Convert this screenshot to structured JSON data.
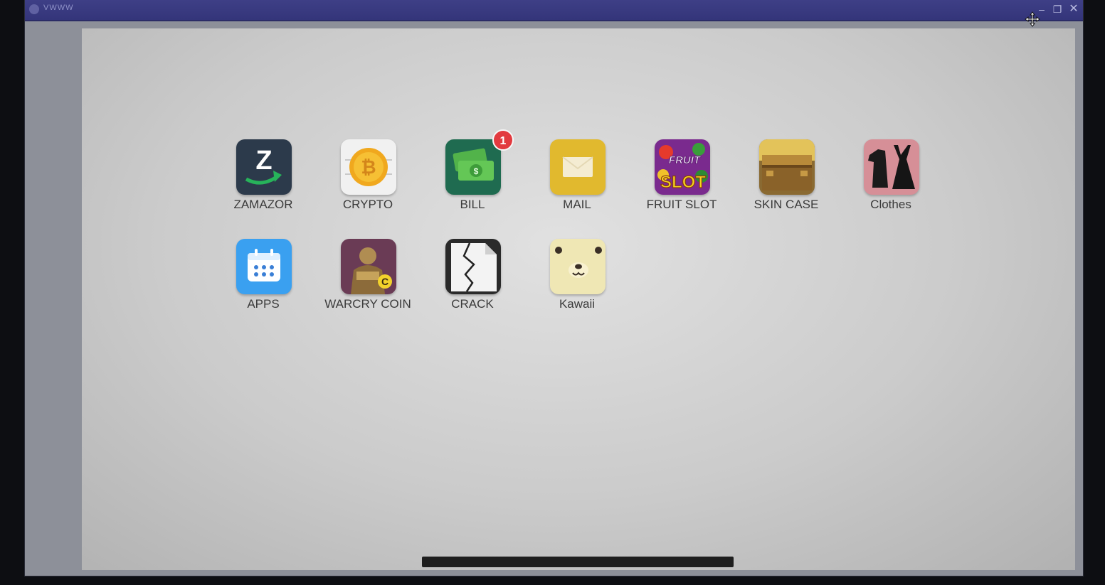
{
  "window": {
    "title": "VWWW",
    "controls": {
      "minimize": "–",
      "maximize": "❐",
      "close": "✕"
    }
  },
  "apps": [
    {
      "label": "ZAMAZOR",
      "icon": "zamazor-icon"
    },
    {
      "label": "CRYPTO",
      "icon": "bitcoin-coin-icon"
    },
    {
      "label": "BILL",
      "icon": "money-bills-icon",
      "badge": "1"
    },
    {
      "label": "MAIL",
      "icon": "envelope-icon"
    },
    {
      "label": "FRUIT SLOT",
      "icon": "fruit-slot-icon",
      "icon_text_top": "FRUIT",
      "icon_text_bottom": "SLOT"
    },
    {
      "label": "SKIN CASE",
      "icon": "treasure-chest-icon"
    },
    {
      "label": "Clothes",
      "icon": "clothes-icon"
    },
    {
      "label": "APPS",
      "icon": "calendar-icon"
    },
    {
      "label": "WARCRY COIN",
      "icon": "warrior-coin-icon"
    },
    {
      "label": "CRACK",
      "icon": "cracked-file-icon"
    },
    {
      "label": "Kawaii",
      "icon": "bear-face-icon"
    }
  ],
  "colors": {
    "titlebar": "#3a3b80",
    "badge": "#e23a3f",
    "desktop": "#d6d6d6"
  }
}
